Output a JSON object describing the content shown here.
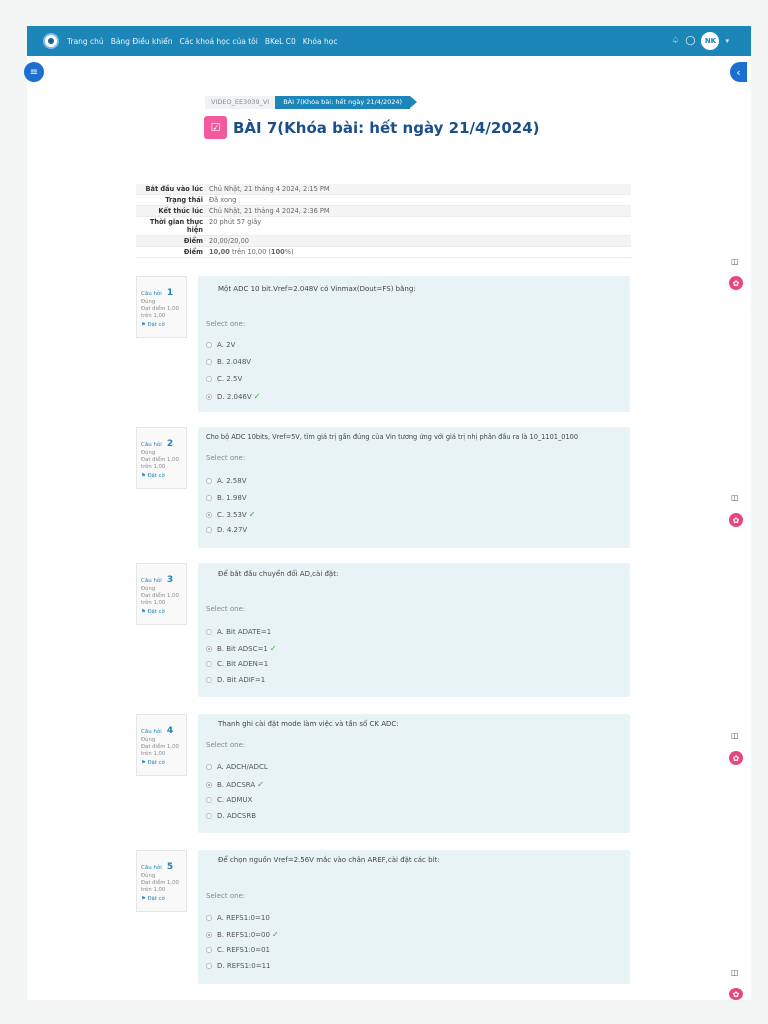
{
  "nav": {
    "items": [
      "Trang chủ",
      "Bảng Điều khiển",
      "Các khoá học của tôi",
      "BKeL C0",
      "Khóa học"
    ],
    "avatar": "NK",
    "icons": [
      "bell-icon",
      "chat-icon"
    ]
  },
  "breadcrumb": [
    "VIDEO_EE3039_VI",
    "BÀI 7(Khóa bài: hết ngày 21/4/2024)"
  ],
  "title": "BÀI 7(Khóa bài: hết ngày 21/4/2024)",
  "summary": [
    {
      "label": "Bắt đầu vào lúc",
      "value": "Chủ Nhật, 21 tháng 4 2024, 2:15 PM"
    },
    {
      "label": "Trạng thái",
      "value": "Đã xong"
    },
    {
      "label": "Kết thúc lúc",
      "value": "Chủ Nhật, 21 tháng 4 2024, 2:36 PM"
    },
    {
      "label": "Thời gian thực hiện",
      "value": "20 phút 57 giây"
    },
    {
      "label": "Điểm",
      "value": "20,00/20,00"
    },
    {
      "label": "Điểm",
      "value_bold": "10,00",
      "value_rest": " trên 10,00 (",
      "value_pct": "100",
      "value_end": "%)"
    }
  ],
  "question_meta": {
    "label": "Câu hỏi",
    "state": "Đúng",
    "grade1": "Đạt điểm 1,00",
    "grade2": "trên 1,00",
    "flag": "Đặt cờ"
  },
  "questions": [
    {
      "num": "1",
      "text": "Một ADC 10 bit.Vref=2.048V có Vinmax(Dout=FS) bằng:",
      "prompt": "Select one:",
      "options": [
        "A.  2V",
        "B.  2.048V",
        "C.  2.5V",
        "D.  2.046V"
      ],
      "selected": 3
    },
    {
      "num": "2",
      "text": "Cho bộ ADC 10bits, Vref=5V, tìm giá trị gần đúng của Vin tương ứng với giá trị nhị phân đầu ra là 10_1101_0100",
      "prompt": "Select one:",
      "options": [
        "A.  2.58V",
        "B.  1.98V",
        "C.  3.53V",
        "D.  4.27V"
      ],
      "selected": 2
    },
    {
      "num": "3",
      "text": "Để bắt đầu chuyển đổi AD,cài đặt:",
      "prompt": "Select one:",
      "options": [
        "A.  Bit ADATE=1",
        "B.  Bit ADSC=1",
        "C.  Bit ADEN=1",
        "D.  Bit ADIF=1"
      ],
      "selected": 1
    },
    {
      "num": "4",
      "text": "Thanh ghi cài đặt mode làm việc và tần số CK ADC:",
      "prompt": "Select one:",
      "options": [
        "A.  ADCH/ADCL",
        "B.  ADCSRA",
        "C.  ADMUX",
        "D.  ADCSRB"
      ],
      "selected": 1
    },
    {
      "num": "5",
      "text": "Để chọn nguồn Vref=2.56V mắc vào chân AREF,cài đặt các bit:",
      "prompt": "Select one:",
      "options": [
        "A.  REFS1:0=10",
        "B.  REFS1:0=00",
        "C.  REFS1:0=01",
        "D.  REFS1:0=11"
      ],
      "selected": 1
    }
  ]
}
